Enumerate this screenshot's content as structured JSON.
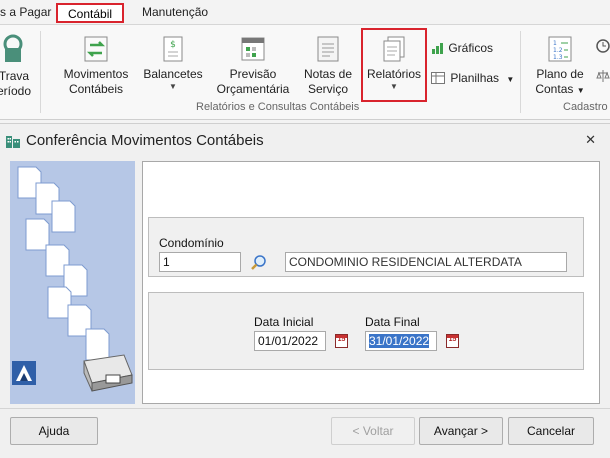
{
  "ribbon_tabs": [
    {
      "label": "s a Pagar"
    },
    {
      "label": "Contábil",
      "active": true
    },
    {
      "label": "Manutenção"
    }
  ],
  "ribbon": {
    "trava_label": "Trava",
    "periodo_label": "eríodo",
    "movimentos_label_1": "Movimentos",
    "movimentos_label_2": "Contábeis",
    "balancetes_label": "Balancetes",
    "previsao_label_1": "Previsão",
    "previsao_label_2": "Orçamentária",
    "notas_label_1": "Notas de",
    "notas_label_2": "Serviço",
    "relatorios_label": "Relatórios",
    "graficos_label": "Gráficos",
    "planilhas_label": "Planilhas",
    "plano_label_1": "Plano de",
    "plano_label_2": "Contas",
    "group_relatorios": "Relatórios e Consultas Contábeis",
    "group_cadastro": "Cadastro"
  },
  "dialog": {
    "title": "Conferência Movimentos Contábeis",
    "condominio_label": "Condomínio",
    "condominio_code": "1",
    "condominio_name": "CONDOMINIO RESIDENCIAL ALTERDATA",
    "data_inicial_label": "Data Inicial",
    "data_inicial_value": "01/01/2022",
    "data_final_label": "Data Final",
    "data_final_value": "31/01/2022",
    "calendar_glyph": "15",
    "buttons": {
      "ajuda": "Ajuda",
      "voltar": "< Voltar",
      "avancar": "Avançar >",
      "cancelar": "Cancelar"
    }
  },
  "colors": {
    "highlight": "#d9232d",
    "side_panel": "#b6c7e6",
    "selection": "#3a74c8"
  }
}
